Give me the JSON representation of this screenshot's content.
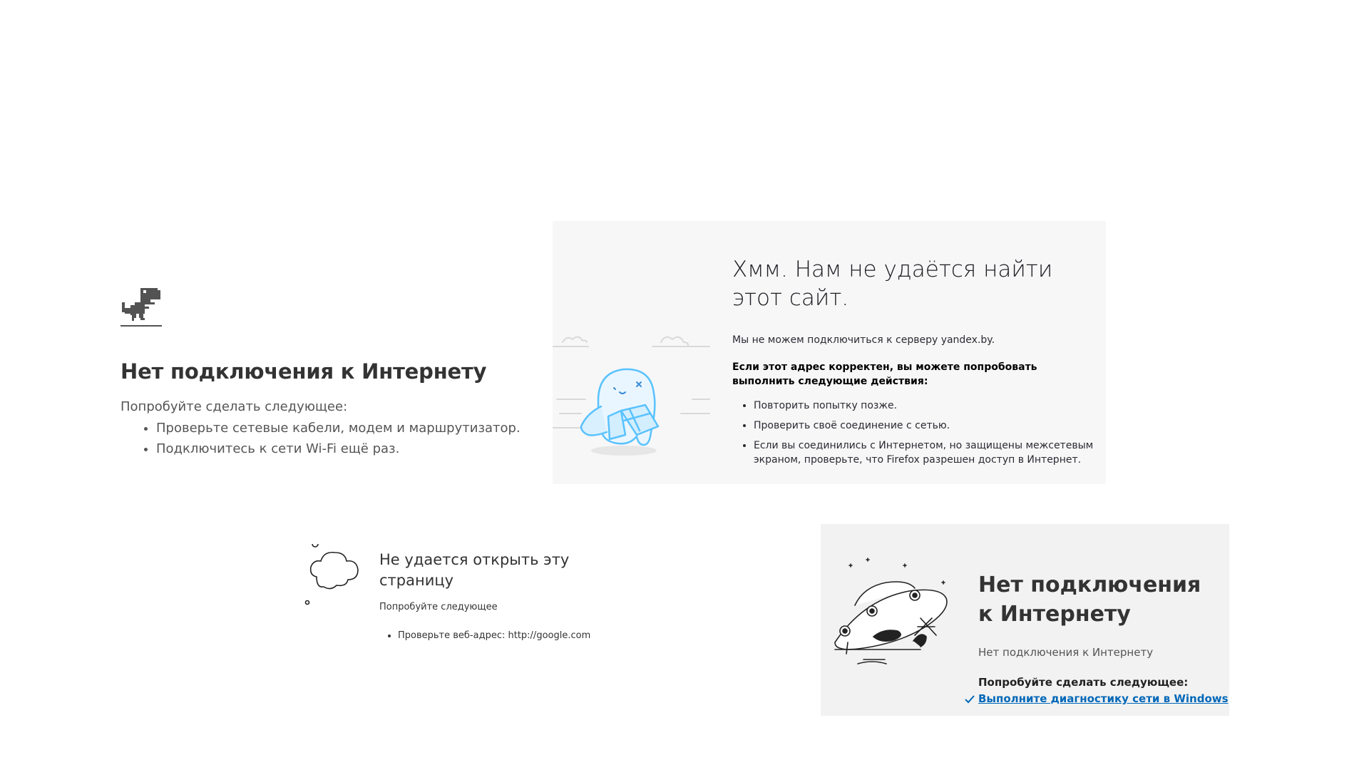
{
  "chrome": {
    "title": "Нет подключения к Интернету",
    "intro": "Попробуйте сделать следующее:",
    "items": [
      "Проверьте сетевые кабели, модем и маршрутизатор.",
      "Подключитесь к сети Wi-Fi ещё раз."
    ],
    "icon": "dino-icon"
  },
  "firefox": {
    "title": "Хмм. Нам не удаётся найти этот сайт.",
    "message": "Мы не можем подключиться к серверу yandex.by.",
    "bold_message": "Если этот адрес корректен, вы можете попробовать выполнить следующие действия:",
    "items": [
      "Повторить попытку позже.",
      "Проверить своё соединение с сетью.",
      "Если вы соединились с Интернетом, но защищены межсетевым экраном, проверьте, что Firefox разрешен доступ в Интернет."
    ],
    "illustration": "confused-character-with-map",
    "colors": {
      "illustration_blue": "#59c2ff",
      "background": "#f7f7f7"
    }
  },
  "edge_old": {
    "title": "Не удается открыть эту страницу",
    "try_label": "Попробуйте следующее",
    "items": [
      "Проверьте веб-адрес: http://google.com"
    ],
    "icon": "thought-cloud-icon"
  },
  "windows": {
    "title": "Нет подключения к Интернету",
    "subtitle": "Нет подключения к Интернету",
    "try_label": "Попробуйте сделать следующее:",
    "diagnostics_link": "Выполните диагностику сети в Windows",
    "illustration": "ufo-icon",
    "colors": {
      "link": "#0067b8",
      "background": "#f2f2f2"
    }
  }
}
